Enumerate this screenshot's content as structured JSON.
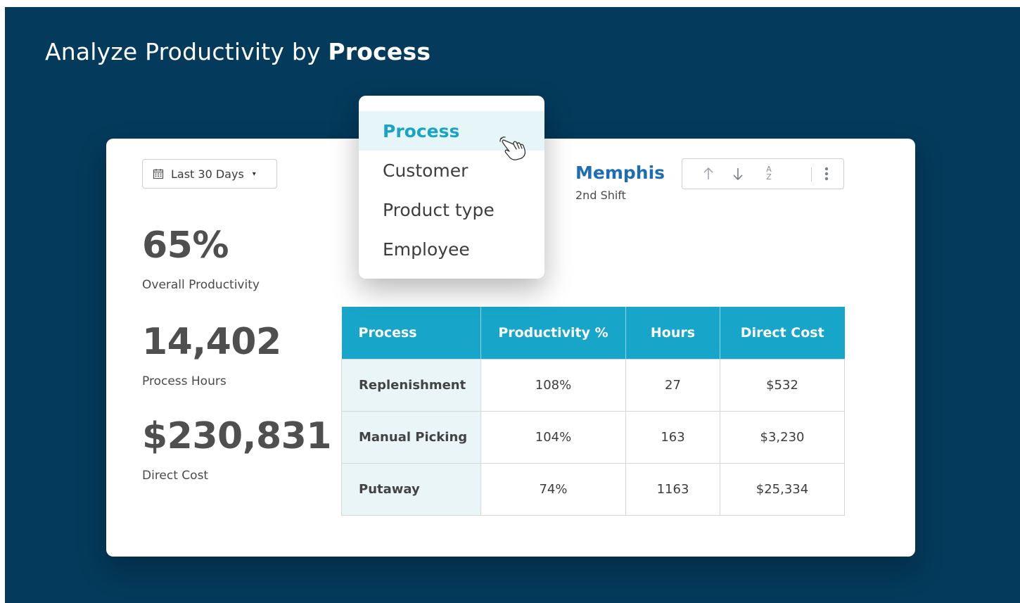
{
  "headline": {
    "prefix": "Analyze Productivity by ",
    "emphasis": "Process"
  },
  "date_filter": {
    "label": "Last 30 Days",
    "icon": "calendar-icon",
    "caret": "▾"
  },
  "kpis": [
    {
      "value": "65%",
      "label": "Overall Productivity"
    },
    {
      "value": "14,402",
      "label": "Process Hours"
    },
    {
      "value": "$230,831",
      "label": "Direct Cost"
    }
  ],
  "location": {
    "city": "Memphis",
    "shift": "2nd Shift"
  },
  "toolbar": {
    "icons": [
      "sort-ascending-icon",
      "sort-descending-icon",
      "sort-alpha-icon",
      "more-vertical-icon"
    ],
    "az_top": "A",
    "az_bottom": "Z"
  },
  "group_by_menu": {
    "items": [
      "Process",
      "Customer",
      "Product type",
      "Employee"
    ],
    "selected": "Process"
  },
  "table": {
    "columns": [
      "Process",
      "Productivity %",
      "Hours",
      "Direct Cost"
    ],
    "rows": [
      [
        "Replenishment",
        "108%",
        "27",
        "$532"
      ],
      [
        "Manual Picking",
        "104%",
        "163",
        "$3,230"
      ],
      [
        "Putaway",
        "74%",
        "1163",
        "$25,334"
      ]
    ]
  },
  "colors": {
    "background": "#043a5b",
    "accent": "#17a6c9",
    "city": "#1f6db3",
    "row_header_bg": "#e9f5f7"
  }
}
